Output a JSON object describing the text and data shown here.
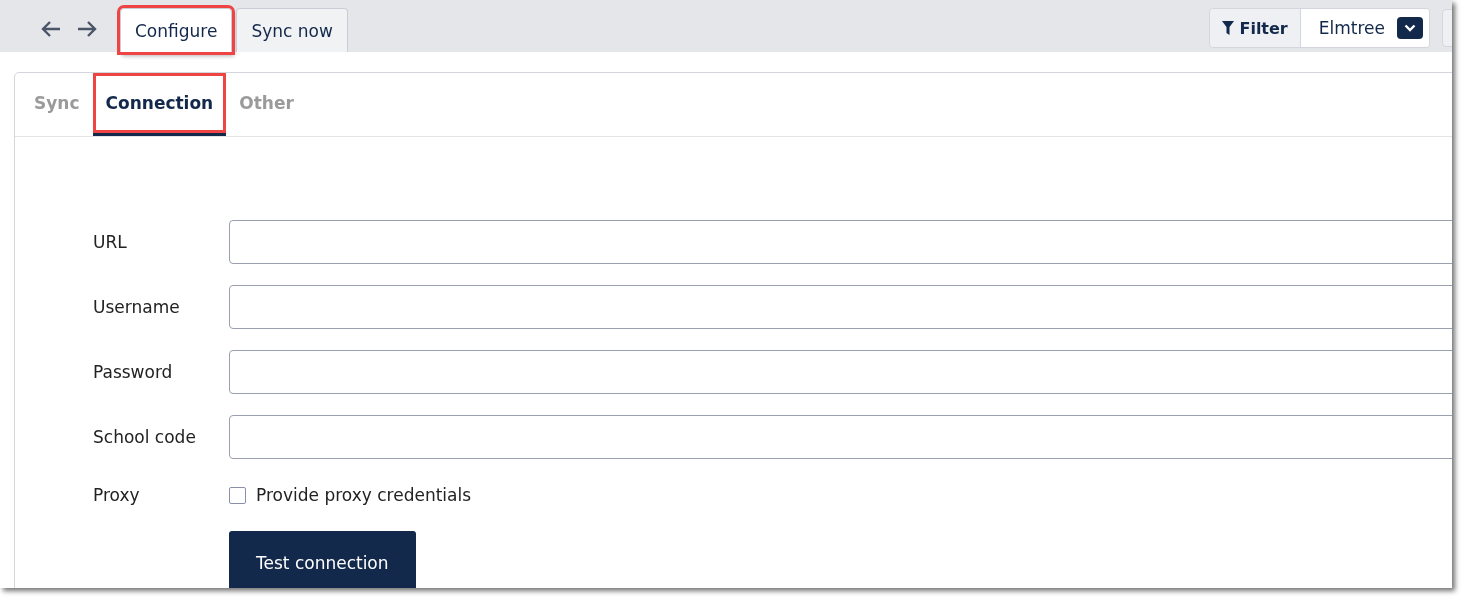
{
  "top_tabs": [
    {
      "label": "Configure",
      "selected": true,
      "highlighted": true
    },
    {
      "label": "Sync now",
      "selected": false,
      "highlighted": false
    }
  ],
  "filter": {
    "label": "Filter",
    "value": "Elmtree"
  },
  "sub_tabs": [
    {
      "label": "Sync",
      "selected": false,
      "highlighted": false
    },
    {
      "label": "Connection",
      "selected": true,
      "highlighted": true
    },
    {
      "label": "Other",
      "selected": false,
      "highlighted": false
    }
  ],
  "fields": [
    {
      "label": "URL"
    },
    {
      "label": "Username"
    },
    {
      "label": "Password"
    },
    {
      "label": "School code"
    }
  ],
  "proxy": {
    "label": "Proxy",
    "option": "Provide proxy credentials",
    "checked": false
  },
  "button": "Test connection"
}
